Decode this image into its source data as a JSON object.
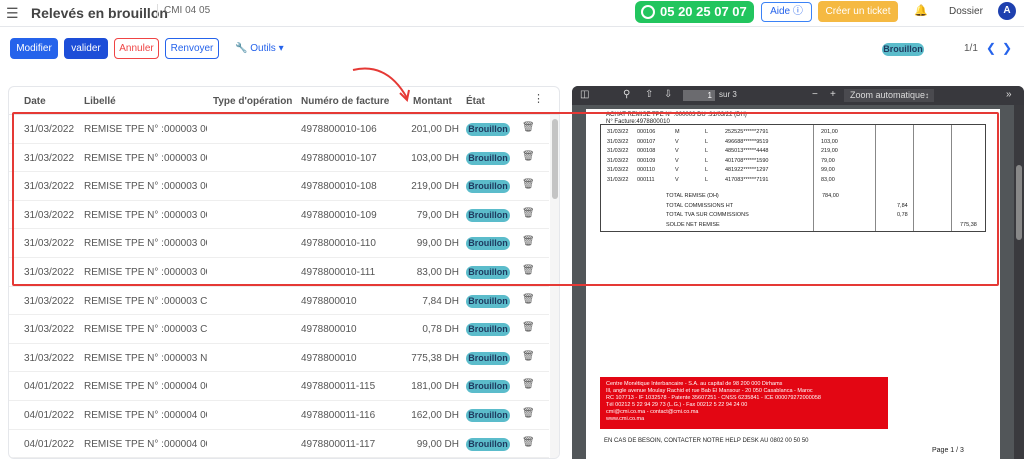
{
  "header": {
    "title": "Relevés en brouillon",
    "breadcrumb": "CMI 04 05",
    "phone": "05 20 25 07 07",
    "help_label": "Aide",
    "ticket_label": "Créer un ticket",
    "folder_label": "Dossier",
    "avatar_letter": "A"
  },
  "toolbar": {
    "modify": "Modifier",
    "validate": "valider",
    "cancel": "Annuler",
    "resend": "Renvoyer",
    "tools": "Outils",
    "status": "Brouillon",
    "pager": "1/1"
  },
  "table": {
    "columns": [
      "Date",
      "Libellé",
      "Type d'opération",
      "Numéro de facture",
      "Montant",
      "État"
    ],
    "rows": [
      {
        "date": "31/03/2022",
        "label": "REMISE TPE N° :000003 0001...",
        "type": "",
        "invoice": "4978800010-106",
        "amount": "201,00 DH",
        "status": "Brouillon"
      },
      {
        "date": "31/03/2022",
        "label": "REMISE TPE N° :000003 0001...",
        "type": "",
        "invoice": "4978800010-107",
        "amount": "103,00 DH",
        "status": "Brouillon"
      },
      {
        "date": "31/03/2022",
        "label": "REMISE TPE N° :000003 0001...",
        "type": "",
        "invoice": "4978800010-108",
        "amount": "219,00 DH",
        "status": "Brouillon"
      },
      {
        "date": "31/03/2022",
        "label": "REMISE TPE N° :000003 0001...",
        "type": "",
        "invoice": "4978800010-109",
        "amount": "79,00 DH",
        "status": "Brouillon"
      },
      {
        "date": "31/03/2022",
        "label": "REMISE TPE N° :000003 000110",
        "type": "",
        "invoice": "4978800010-110",
        "amount": "99,00 DH",
        "status": "Brouillon"
      },
      {
        "date": "31/03/2022",
        "label": "REMISE TPE N° :000003 000111",
        "type": "",
        "invoice": "4978800010-111",
        "amount": "83,00 DH",
        "status": "Brouillon"
      },
      {
        "date": "31/03/2022",
        "label": "REMISE TPE N° :000003 COM...",
        "type": "",
        "invoice": "4978800010",
        "amount": "7,84 DH",
        "status": "Brouillon"
      },
      {
        "date": "31/03/2022",
        "label": "REMISE TPE N° :000003 COM...",
        "type": "",
        "invoice": "4978800010",
        "amount": "0,78 DH",
        "status": "Brouillon"
      },
      {
        "date": "31/03/2022",
        "label": "REMISE TPE N° :000003 NET R...",
        "type": "",
        "invoice": "4978800010",
        "amount": "775,38 DH",
        "status": "Brouillon"
      },
      {
        "date": "04/01/2022",
        "label": "REMISE TPE N° :000004 000115",
        "type": "",
        "invoice": "4978800011-115",
        "amount": "181,00 DH",
        "status": "Brouillon"
      },
      {
        "date": "04/01/2022",
        "label": "REMISE TPE N° :000004 000116",
        "type": "",
        "invoice": "4978800011-116",
        "amount": "162,00 DH",
        "status": "Brouillon"
      },
      {
        "date": "04/01/2022",
        "label": "REMISE TPE N° :000004 000117",
        "type": "",
        "invoice": "4978800011-117",
        "amount": "99,00 DH",
        "status": "Brouillon"
      }
    ]
  },
  "pdf": {
    "page_current": "1",
    "page_total": "sur 3",
    "zoom": "Zoom automatique",
    "doc_title": "ACHAT REMISE TPE N° :000003 DU :31/03/22 (DH)",
    "doc_invoice": "N° Facture:4978800010",
    "doc_rows": [
      {
        "date": "31/03/22",
        "num": "000106",
        "type": "M",
        "flag": "L",
        "card": "252525******2791",
        "amount": "201,00"
      },
      {
        "date": "31/03/22",
        "num": "000107",
        "type": "V",
        "flag": "L",
        "card": "496688******9519",
        "amount": "103,00"
      },
      {
        "date": "31/03/22",
        "num": "000108",
        "type": "V",
        "flag": "L",
        "card": "485013******4448",
        "amount": "219,00"
      },
      {
        "date": "31/03/22",
        "num": "000109",
        "type": "V",
        "flag": "L",
        "card": "401708******1590",
        "amount": "79,00"
      },
      {
        "date": "31/03/22",
        "num": "000110",
        "type": "V",
        "flag": "L",
        "card": "481922******1297",
        "amount": "99,00"
      },
      {
        "date": "31/03/22",
        "num": "000111",
        "type": "V",
        "flag": "L",
        "card": "417083******7191",
        "amount": "83,00"
      }
    ],
    "totals": {
      "remise_label": "TOTAL REMISE (DH)",
      "remise_value": "784,00",
      "commissions_label": "TOTAL COMMISSIONS HT",
      "commissions_value": "7,84",
      "tva_label": "TOTAL TVA SUR COMMISSIONS",
      "tva_value": "0,78",
      "solde_label": "SOLDE NET REMISE",
      "solde_value": "775,38"
    },
    "footer_lines": [
      "Centre Monétique Interbancaire - S.A. au capital de 98 200 000 Dirhams",
      "Ill, angle avenue Moulay Rachid et rue Bab El Mansour - 20 050 Casablanca - Maroc",
      "RC 107713 - IF 1032578 - Patente 35607251 - CNSS 6235841 - ICE 000079272000058",
      "Tél 00212 5 22 94 29 73 (L.G.) - Fax 00212 5 22 94 24 00",
      "cmi@cmi.co.ma - contact@cmi.co.ma",
      "www.cmi.co.ma"
    ],
    "help_line": "EN CAS DE BESOIN, CONTACTER NOTRE HELP DESK AU 0802 00 50 50",
    "page_label": "Page 1 / 3"
  },
  "colors": {
    "primary": "#2563eb",
    "success": "#22c55e",
    "warning": "#f5b942",
    "danger": "#ef4444",
    "badge": "#5bbccb",
    "annotation": "#e53935",
    "brand_red": "#e30613"
  }
}
